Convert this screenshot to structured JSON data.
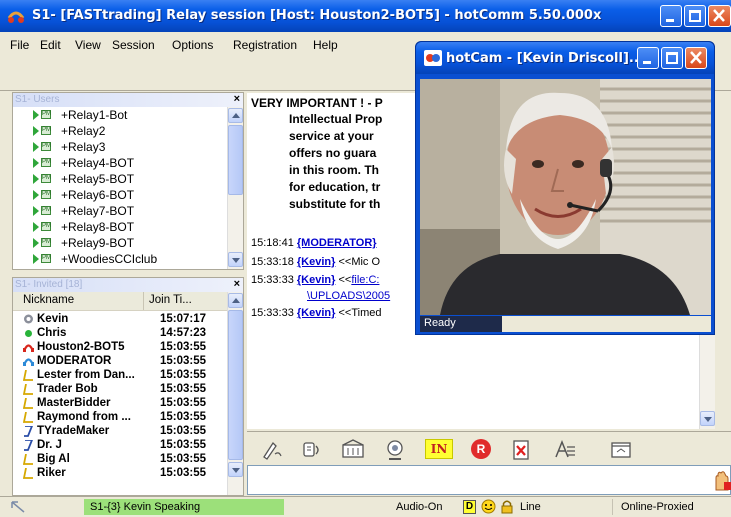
{
  "window": {
    "title": "S1- [FASTtrading] Relay session [Host: Houston2-BOT5] - hotComm 5.50.000x"
  },
  "menu": [
    "File",
    "Edit",
    "View",
    "Session",
    "Options",
    "Registration",
    "Help"
  ],
  "users_panel": {
    "header": "S1- Users",
    "close": "×",
    "items": [
      {
        "label": "+Relay1-Bot"
      },
      {
        "label": "+Relay2"
      },
      {
        "label": "+Relay3"
      },
      {
        "label": "+Relay4-BOT"
      },
      {
        "label": "+Relay5-BOT"
      },
      {
        "label": "+Relay6-BOT"
      },
      {
        "label": "+Relay7-BOT"
      },
      {
        "label": "+Relay8-BOT"
      },
      {
        "label": "+Relay9-BOT"
      },
      {
        "label": "+WoodiesCCIclub"
      }
    ]
  },
  "invited_panel": {
    "header": "S1- Invited [18]",
    "close": "×",
    "columns": [
      "Nickname",
      "Join Ti..."
    ],
    "rows": [
      {
        "nick": "Kevin",
        "time": "15:07:17"
      },
      {
        "nick": "Chris",
        "time": "14:57:23"
      },
      {
        "nick": "Houston2-BOT5",
        "time": "15:03:55"
      },
      {
        "nick": "MODERATOR",
        "time": "15:03:55"
      },
      {
        "nick": "Lester from Dan...",
        "time": "15:03:55"
      },
      {
        "nick": "Trader Bob",
        "time": "15:03:55"
      },
      {
        "nick": "MasterBidder",
        "time": "15:03:55"
      },
      {
        "nick": "Raymond from ...",
        "time": "15:03:55"
      },
      {
        "nick": "TYradeMaker",
        "time": "15:03:55"
      },
      {
        "nick": "Dr. J",
        "time": "15:03:55"
      },
      {
        "nick": "Big Al",
        "time": "15:03:55"
      },
      {
        "nick": "Riker",
        "time": "15:03:55"
      }
    ]
  },
  "chat": {
    "notice_title": "VERY IMPORTANT ! - P",
    "notice_lines": [
      "Intellectual Prop",
      "service at your",
      "offers no guara",
      "in this room. Th",
      "for education, tr",
      "substitute for th"
    ],
    "messages": [
      {
        "time": "15:18:41",
        "nick": "{MODERATOR}",
        "text": ""
      },
      {
        "time": "15:33:18",
        "nick": "{Kevin}",
        "text": " <<Mic O"
      },
      {
        "time": "15:33:33",
        "nick": "{Kevin}",
        "text": " <<",
        "link": "file:C:",
        "cont": "\\UPLOADS\\2005"
      },
      {
        "time": "15:33:33",
        "nick": "{Kevin}",
        "text": " <<Timed"
      }
    ]
  },
  "hotcam": {
    "title": "hotCam - [Kevin Driscoll]...",
    "status": "Ready"
  },
  "tools": {
    "in_label": "IN",
    "r_label": "R"
  },
  "statusbar": {
    "speaking": "S1-{3} Kevin Speaking",
    "audio": "Audio-On",
    "line": "Line",
    "connection": "Online-Proxied",
    "d_label": "D"
  },
  "colors": {
    "xp_blue": "#0a5ee8",
    "speaking_green": "#9ce07a",
    "link_blue": "#0000cc"
  }
}
